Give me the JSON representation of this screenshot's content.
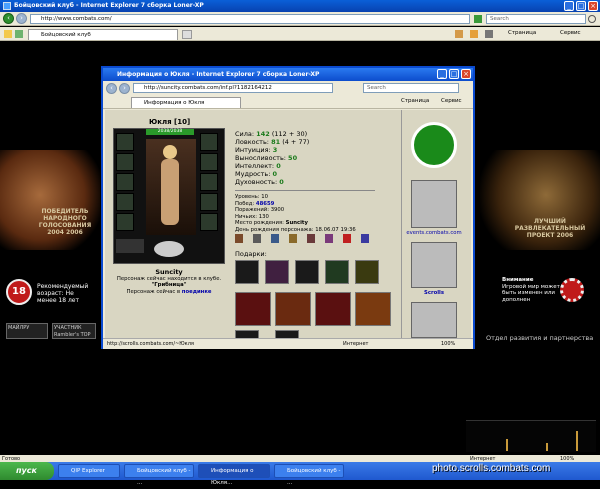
{
  "main_window": {
    "title": "Бойцовский клуб - Internet Explorer 7 сборка Loner-XP",
    "address": "http://www.combats.com/",
    "search_placeholder": "Search",
    "tab": "Бойцовский клуб",
    "commands": [
      "Страница",
      "Сервис"
    ]
  },
  "page": {
    "banner_left": "ПОБЕДИТЕЛЬ НАРОДНОГО ГОЛОСОВАНИЯ 2004 2006",
    "banner_right": "ЛУЧШИЙ РАЗВЛЕКАТЕЛЬНЫЙ ПРОЕКТ 2006",
    "age_badge": "18",
    "age_text": "Рекомендуемый возраст: Не менее 18 лет",
    "right_note_title": "Внимание",
    "right_note": "Игровой мир может быть изменен или дополнен",
    "partners": "Отдел развития и партнерства",
    "counter_label": "МАЙЛРУ",
    "participant_label": "УЧАСТНИК Rambler's TOP"
  },
  "popup": {
    "title": "Информация о Юкля - Internet Explorer 7 сборка Loner-XP",
    "address": "http://suncity.combats.com/inf.pl?1182164212",
    "search_placeholder": "Search",
    "tab": "Информация о Юкля",
    "commands": [
      "Страница",
      "Сервис"
    ],
    "char_name": "Юкля",
    "char_level": "[10]",
    "hp_bar": "2038/2038",
    "city": "Suncity",
    "location1": "Персонаж сейчас находится в клубе.",
    "location2": "\"Грибница\"",
    "location3_prefix": "Персонаж сейчас в",
    "location3_link": "поединке",
    "stats": [
      {
        "label": "Сила:",
        "value": "142",
        "extra": "(112 + 30)"
      },
      {
        "label": "Ловкость:",
        "value": "81",
        "extra": "(4 + 77)"
      },
      {
        "label": "Интуиция:",
        "value": "3",
        "extra": ""
      },
      {
        "label": "Выносливость:",
        "value": "50",
        "extra": ""
      },
      {
        "label": "Интеллект:",
        "value": "0",
        "extra": ""
      },
      {
        "label": "Мудрость:",
        "value": "0",
        "extra": ""
      },
      {
        "label": "Духовность:",
        "value": "0",
        "extra": ""
      }
    ],
    "info": [
      {
        "label": "Уровень:",
        "value": "10"
      },
      {
        "label": "Побед:",
        "value": "48659"
      },
      {
        "label": "Поражений:",
        "value": "3900"
      },
      {
        "label": "Ничьих:",
        "value": "130"
      },
      {
        "label": "Место рождения:",
        "value": "Suncity"
      },
      {
        "label": "День рождения персонажа:",
        "value": "18.06.07 19:36"
      }
    ],
    "gifts_label": "Подарки:",
    "side_links": [
      "events.combats.com",
      "Scrolls"
    ],
    "status_url": "http://scrolls.combats.com/~Юкля",
    "status_zone": "Интернет",
    "zoom": "100%"
  },
  "status_bar": {
    "text": "Готово",
    "zone": "Интернет",
    "zoom": "100%"
  },
  "taskbar": {
    "start": "пуск",
    "tasks": [
      "QIP Explorer",
      "Бойцовский клуб - ...",
      "Информация о Юкля...",
      "Бойцовский клуб - ..."
    ]
  },
  "watermark": "photo.scrolls.combats.com",
  "colors": {
    "accent": "#0a4ad0",
    "stat_value": "#1a7a1a",
    "hp": "#2a9a2a"
  }
}
